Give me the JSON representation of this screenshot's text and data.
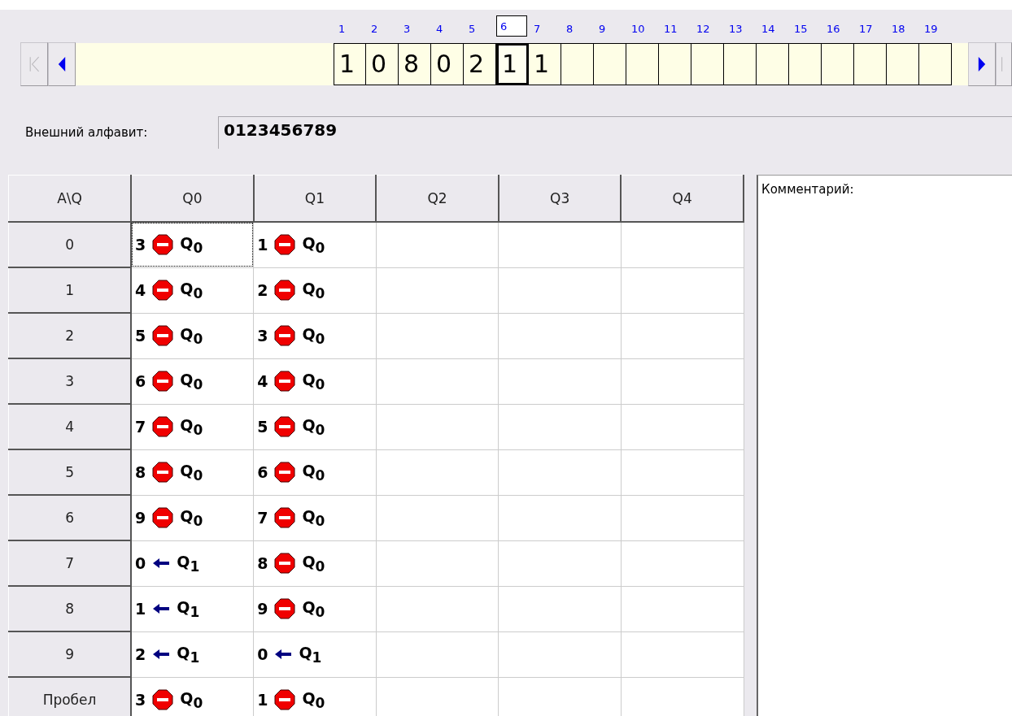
{
  "tape": {
    "cells": [
      {
        "index": "1",
        "symbol": "1",
        "selected": false
      },
      {
        "index": "2",
        "symbol": "0",
        "selected": false
      },
      {
        "index": "3",
        "symbol": "8",
        "selected": false
      },
      {
        "index": "4",
        "symbol": "0",
        "selected": false
      },
      {
        "index": "5",
        "symbol": "2",
        "selected": false
      },
      {
        "index": "6",
        "symbol": "1",
        "selected": true
      },
      {
        "index": "7",
        "symbol": "1",
        "selected": false
      },
      {
        "index": "8",
        "selected": false
      },
      {
        "index": "9",
        "selected": false
      },
      {
        "index": "10",
        "selected": false
      },
      {
        "index": "11",
        "selected": false
      },
      {
        "index": "12",
        "selected": false
      },
      {
        "index": "13",
        "selected": false
      },
      {
        "index": "14",
        "selected": false
      },
      {
        "index": "15",
        "selected": false
      },
      {
        "index": "16",
        "selected": false
      },
      {
        "index": "17",
        "selected": false
      },
      {
        "index": "18",
        "selected": false
      },
      {
        "index": "19",
        "selected": false
      }
    ]
  },
  "alphabet": {
    "label": "Внешний алфавит:",
    "value": "0123456789"
  },
  "table": {
    "corner": "A\\Q",
    "columns": [
      "Q0",
      "Q1",
      "Q2",
      "Q3",
      "Q4"
    ],
    "rows": [
      {
        "symbol": "0",
        "cells": [
          {
            "write": "3",
            "kind": "stop",
            "state": "Q$_{0}$",
            "selected": true
          },
          {
            "write": "1",
            "kind": "stop",
            "state": "Q$_{0}$",
            "selected": false
          }
        ]
      },
      {
        "symbol": "1",
        "cells": [
          {
            "write": "4",
            "kind": "stop",
            "state": "Q$_{0}$",
            "selected": false
          },
          {
            "write": "2",
            "kind": "stop",
            "state": "Q$_{0}$",
            "selected": false
          }
        ]
      },
      {
        "symbol": "2",
        "cells": [
          {
            "write": "5",
            "kind": "stop",
            "state": "Q$_{0}$",
            "selected": false
          },
          {
            "write": "3",
            "kind": "stop",
            "state": "Q$_{0}$",
            "selected": false
          }
        ]
      },
      {
        "symbol": "3",
        "cells": [
          {
            "write": "6",
            "kind": "stop",
            "state": "Q$_{0}$",
            "selected": false
          },
          {
            "write": "4",
            "kind": "stop",
            "state": "Q$_{0}$",
            "selected": false
          }
        ]
      },
      {
        "symbol": "4",
        "cells": [
          {
            "write": "7",
            "kind": "stop",
            "state": "Q$_{0}$",
            "selected": false
          },
          {
            "write": "5",
            "kind": "stop",
            "state": "Q$_{0}$",
            "selected": false
          }
        ]
      },
      {
        "symbol": "5",
        "cells": [
          {
            "write": "8",
            "kind": "stop",
            "state": "Q$_{0}$",
            "selected": false
          },
          {
            "write": "6",
            "kind": "stop",
            "state": "Q$_{0}$",
            "selected": false
          }
        ]
      },
      {
        "symbol": "6",
        "cells": [
          {
            "write": "9",
            "kind": "stop",
            "state": "Q$_{0}$",
            "selected": false
          },
          {
            "write": "7",
            "kind": "stop",
            "state": "Q$_{0}$",
            "selected": false
          }
        ]
      },
      {
        "symbol": "7",
        "cells": [
          {
            "write": "0",
            "kind": "left",
            "state": "Q$_{1}$",
            "selected": false
          },
          {
            "write": "8",
            "kind": "stop",
            "state": "Q$_{0}$",
            "selected": false
          }
        ]
      },
      {
        "symbol": "8",
        "cells": [
          {
            "write": "1",
            "kind": "left",
            "state": "Q$_{1}$",
            "selected": false
          },
          {
            "write": "9",
            "kind": "stop",
            "state": "Q$_{0}$",
            "selected": false
          }
        ]
      },
      {
        "symbol": "9",
        "cells": [
          {
            "write": "2",
            "kind": "left",
            "state": "Q$_{1}$",
            "selected": false
          },
          {
            "write": "0",
            "kind": "left",
            "state": "Q$_{1}$",
            "selected": false
          }
        ]
      },
      {
        "symbol": "Пробел",
        "cells": [
          {
            "write": "3",
            "kind": "stop",
            "state": "Q$_{0}$",
            "selected": false
          },
          {
            "write": "1",
            "kind": "stop",
            "state": "Q$_{0}$",
            "selected": false
          }
        ]
      }
    ]
  },
  "comment": {
    "label": "Комментарий:"
  }
}
